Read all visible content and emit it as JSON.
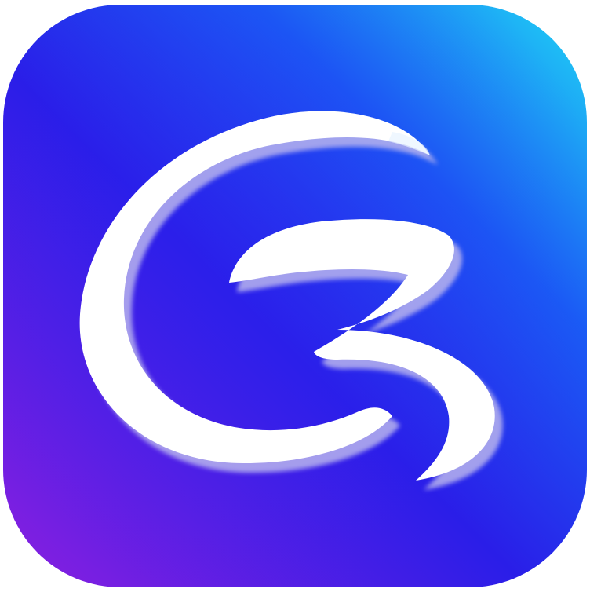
{
  "icon": {
    "name": "stylized-g-logo",
    "colors": {
      "top_right": "#1fd6f5",
      "upper_mid": "#1a5cf5",
      "center": "#2a1ee8",
      "bottom_left": "#8a1fe0",
      "glyph": "#ffffff",
      "glyph_shadow": "#b8b4ee"
    }
  }
}
